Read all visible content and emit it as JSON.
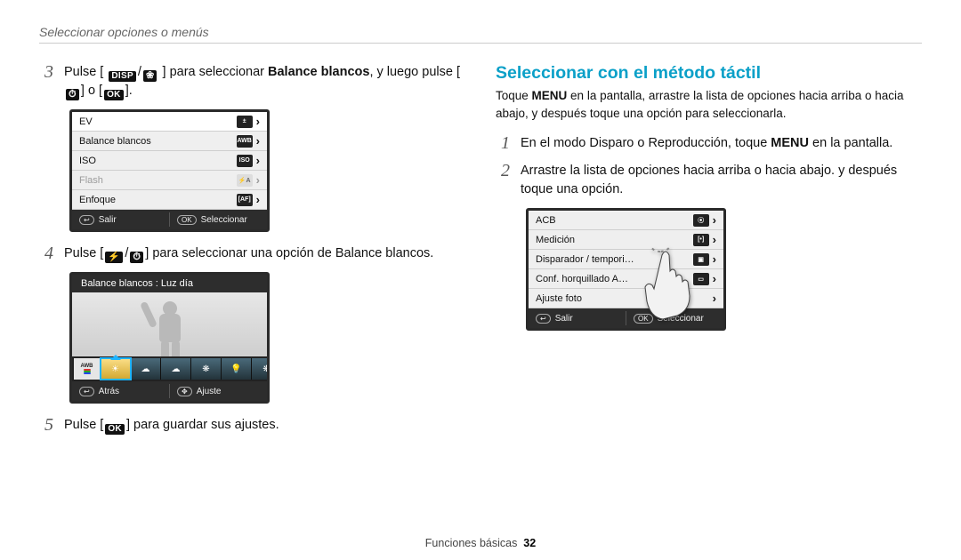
{
  "breadcrumb": "Seleccionar opciones o menús",
  "left": {
    "step3": {
      "num": "3",
      "text_a": "Pulse [",
      "disp": "DISP",
      "slash": "/",
      "macro_icon": "flower-icon",
      "text_b": "] para seleccionar",
      "bold_target": " Balance blancos",
      "text_c": ", y luego pulse [",
      "timer_icon": "timer-icon",
      "text_d": "] o [",
      "ok": "OK",
      "text_e": "]."
    },
    "lcd_menu": {
      "items": [
        {
          "label": "EV",
          "icon": "±",
          "sel": true
        },
        {
          "label": "Balance blancos",
          "icon": "AWB"
        },
        {
          "label": "ISO",
          "icon": "ISO"
        },
        {
          "label": "Flash",
          "icon": "⚡A",
          "dim": true
        },
        {
          "label": "Enfoque",
          "icon": "[AF]"
        }
      ],
      "footer": {
        "left_icon": "↩",
        "left": "Salir",
        "right_icon": "OK",
        "right": "Seleccionar"
      }
    },
    "step4": {
      "num": "4",
      "text_a": "Pulse [",
      "flash_icon": "flash-icon",
      "slash": "/",
      "timer_icon": "timer-icon",
      "text_b": "] para seleccionar una opción de Balance blancos."
    },
    "lcd_preview": {
      "title": "Balance blancos : Luz día",
      "wb_options": [
        "AWB",
        "☀",
        "☁",
        "☁",
        "❋",
        "💡",
        "❋"
      ],
      "footer": {
        "left_icon": "↩",
        "left": "Atrás",
        "right_icon": "✥",
        "right": "Ajuste"
      }
    },
    "step5": {
      "num": "5",
      "text_a": "Pulse [",
      "ok": "OK",
      "text_b": "] para guardar sus ajustes."
    }
  },
  "right": {
    "heading": "Seleccionar con el método táctil",
    "intro_a": "Toque",
    "intro_menu": " MENU ",
    "intro_b": "en la pantalla, arrastre la lista de opciones hacia arriba o hacia abajo, y después toque una opción para seleccionarla.",
    "step1": {
      "num": "1",
      "a": "En el modo Disparo o Reproducción, toque",
      "menu": " MENU ",
      "b": "en la pantalla."
    },
    "step2": {
      "num": "2",
      "text": "Arrastre la lista de opciones hacia arriba o hacia abajo. y después toque una opción."
    },
    "lcd_menu": {
      "items": [
        {
          "label": "ACB",
          "icon": "⦿"
        },
        {
          "label": "Medición",
          "icon": "[•]"
        },
        {
          "label": "Disparador / tempori…",
          "icon": "▣"
        },
        {
          "label": "Conf. horquillado A…",
          "icon": "▭"
        },
        {
          "label": "Ajuste foto",
          "icon": ""
        }
      ],
      "footer": {
        "left_icon": "↩",
        "left": "Salir",
        "right_icon": "OK",
        "right": "Seleccionar"
      }
    }
  },
  "footer": {
    "section": "Funciones básicas",
    "page": "32"
  }
}
